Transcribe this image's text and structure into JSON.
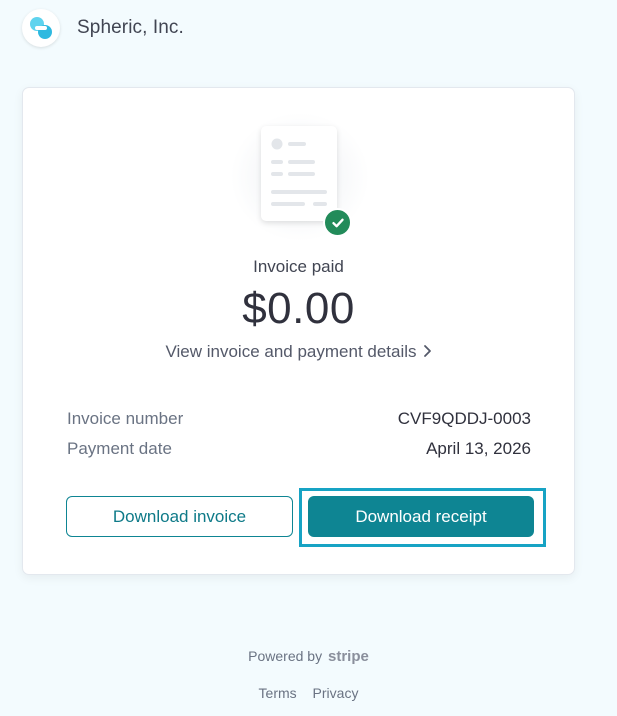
{
  "header": {
    "company_name": "Spheric, Inc.",
    "logo_icon": "spheric-logo-icon"
  },
  "invoice": {
    "status": "Invoice paid",
    "amount": "$0.00",
    "details_link": "View invoice and payment details",
    "details_chevron": "chevron-right-icon",
    "illustration": "invoice-document-icon",
    "check_icon": "check-circle-icon",
    "rows": [
      {
        "label": "Invoice number",
        "value": "CVF9QDDJ-0003"
      },
      {
        "label": "Payment date",
        "value": "April 13, 2026"
      }
    ],
    "download_invoice_label": "Download invoice",
    "download_receipt_label": "Download receipt"
  },
  "footer": {
    "powered_by": "Powered by",
    "brand": "stripe",
    "terms": "Terms",
    "privacy": "Privacy"
  },
  "colors": {
    "background": "#f3fbfe",
    "accent": "#0e8593",
    "success": "#228b5a",
    "focus": "#17a3c4"
  }
}
